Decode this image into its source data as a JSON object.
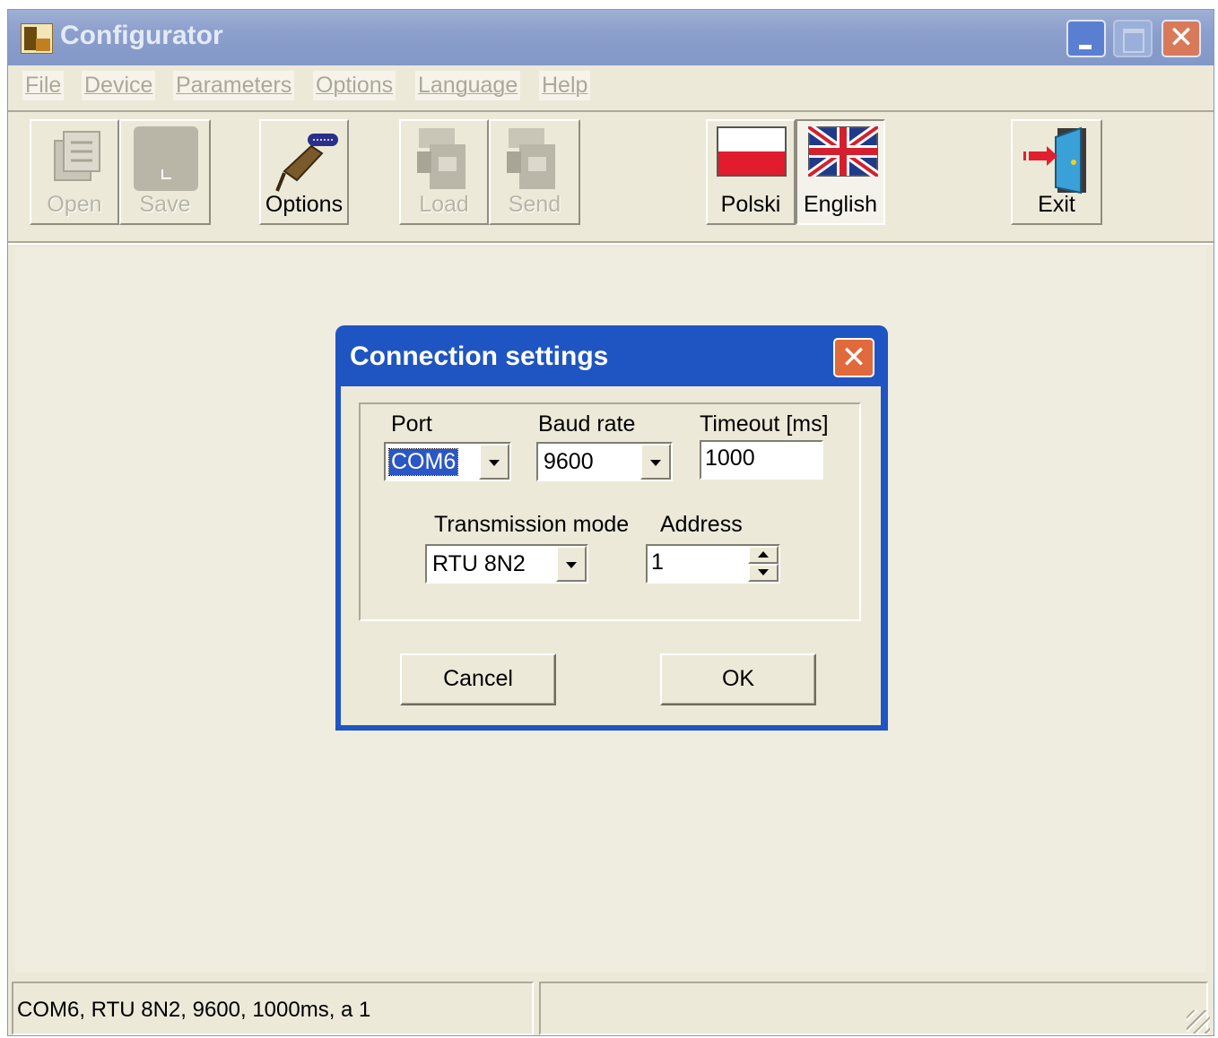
{
  "window": {
    "title": "Configurator"
  },
  "menu": [
    "File",
    "Device",
    "Parameters",
    "Options",
    "Language",
    "Help"
  ],
  "toolbar": {
    "open": "Open",
    "save": "Save",
    "options": "Options",
    "load": "Load",
    "send": "Send",
    "polski": "Polski",
    "english": "English",
    "exit": "Exit"
  },
  "dialog": {
    "title": "Connection settings",
    "port_label": "Port",
    "port_value": "COM6",
    "baud_label": "Baud rate",
    "baud_value": "9600",
    "timeout_label": "Timeout [ms]",
    "timeout_value": "1000",
    "mode_label": "Transmission mode",
    "mode_value": "RTU 8N2",
    "address_label": "Address",
    "address_value": "1",
    "cancel": "Cancel",
    "ok": "OK"
  },
  "status": {
    "text": "COM6, RTU 8N2, 9600, 1000ms, a 1"
  },
  "colors": {
    "titlebar": "#8c9fcc",
    "dialog_frame": "#1f55c2",
    "close_button": "#e06a3c",
    "face": "#ece9d8"
  }
}
